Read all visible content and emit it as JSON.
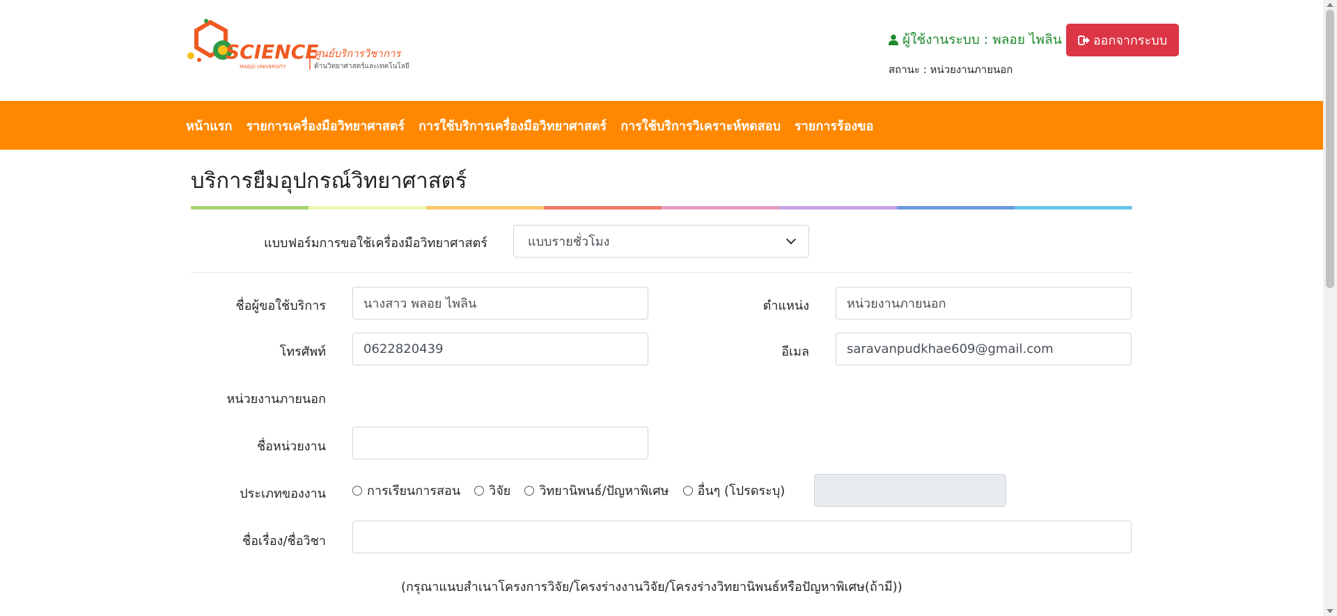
{
  "header": {
    "logo_word": "SCIENCE",
    "logo_sub": "MAEJO UNIVERSITY",
    "logo_thai_title": "ศูนย์บริการวิชาการ",
    "logo_thai_sub": "ด้านวิทยาศาสตร์และเทคโนโลยี",
    "user_label": "ผู้ใช้งานระบบ : พลอย ไพลิน",
    "status_label": "สถานะ : หน่วยงานภายนอก",
    "logout_label": "ออกจากระบบ"
  },
  "nav": {
    "items": [
      "หน้าแรก",
      "รายการเครื่องมือวิทยาศาสตร์",
      "การใช้บริการเครื่องมือวิทยาศาสตร์",
      "การใช้บริการวิเคราะห์ทดสอบ",
      "รายการร้องขอ"
    ]
  },
  "main": {
    "title": "บริการยืมอุปกรณ์วิทยาศาสตร์",
    "form_type_label": "แบบฟอร์มการขอใช้เครื่องมือวิทยาศาสตร์",
    "form_type_value": "แบบรายชั่วโมง",
    "requester_label": "ชื่อผู้ขอใช้บริการ",
    "requester_value": "นางสาว พลอย  ไพลิน",
    "position_label": "ตำแหน่ง",
    "position_value": "หน่วยงานภายนอก",
    "phone_label": "โทรศัพท์",
    "phone_value": "0622820439",
    "email_label": "อีเมล",
    "email_value": "saravanpudkhae609@gmail.com",
    "section_label": "หน่วยงานภายนอก",
    "org_name_label": "ชื่อหน่วยงาน",
    "org_name_value": "",
    "work_type_label": "ประเภทของงาน",
    "work_type_options": [
      "การเรียนการสอน",
      "วิจัย",
      "วิทยานิพนธ์/ปัญหาพิเศษ",
      "อื่นๆ (โปรดระบุ)"
    ],
    "other_value": "",
    "topic_label": "ชื่อเรื่อง/ชื่อวิชา",
    "topic_value": "",
    "note": "(กรุณาแนบสำเนาโครงการวิจัย/โครงร่างงานวิจัย/โครงร่างวิทยานิพนธ์หรือปัญหาพิเศษ(ถ้ามี))"
  },
  "colors": {
    "nav_bg": "#ff8800",
    "logout_bg": "#dc3545",
    "user_green": "#1e8a2c",
    "rainbow": [
      "#a8d26f",
      "#eef5b5",
      "#fbc96a",
      "#ee7b6a",
      "#e39ec0",
      "#c7a3e2",
      "#6b9bdc",
      "#6cc3e8"
    ]
  }
}
